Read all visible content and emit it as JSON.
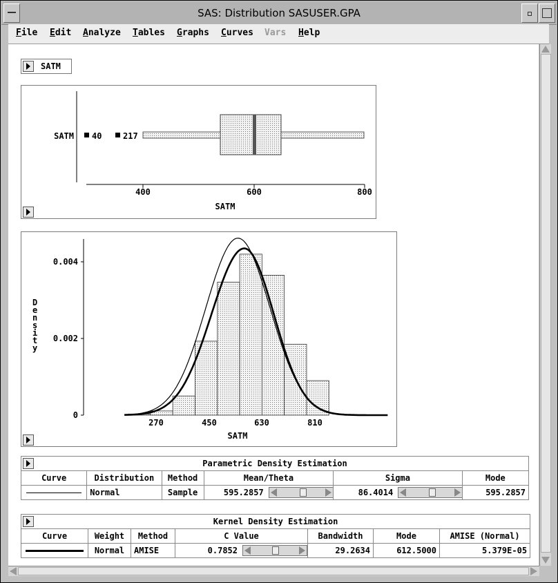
{
  "window": {
    "title": "SAS: Distribution SASUSER.GPA"
  },
  "menu": [
    {
      "label": "File",
      "enabled": true
    },
    {
      "label": "Edit",
      "enabled": true
    },
    {
      "label": "Analyze",
      "enabled": true
    },
    {
      "label": "Tables",
      "enabled": true
    },
    {
      "label": "Graphs",
      "enabled": true
    },
    {
      "label": "Curves",
      "enabled": true
    },
    {
      "label": "Vars",
      "enabled": false
    },
    {
      "label": "Help",
      "enabled": true
    }
  ],
  "variable_button": {
    "label": "SATM"
  },
  "boxplot": {
    "var_label": "SATM",
    "outliers": [
      {
        "label": "40",
        "value": 285
      },
      {
        "label": "217",
        "value": 340
      }
    ],
    "whisker_low": 400,
    "q1": 545,
    "median": 600,
    "q3": 650,
    "whisker_high": 800,
    "xaxis": {
      "label": "SATM",
      "ticks": [
        "400",
        "600",
        "800"
      ],
      "range": [
        300,
        800
      ]
    }
  },
  "histogram": {
    "ylabel": "Density",
    "xlabel": "SATM",
    "yticks": [
      "0",
      "0.002",
      "0.004"
    ],
    "xticks": [
      "270",
      "450",
      "630",
      "810"
    ]
  },
  "chart_data": {
    "type": "bar",
    "title": "",
    "xlabel": "SATM",
    "ylabel": "Density",
    "bin_width": 60,
    "bin_starts": [
      300,
      360,
      420,
      480,
      540,
      600,
      660,
      720,
      780
    ],
    "values": [
      3e-05,
      0.00011,
      0.0005,
      0.00193,
      0.00347,
      0.0042,
      0.00365,
      0.00185,
      0.0009
    ],
    "ylim": [
      0,
      0.0045
    ],
    "xlim": [
      180,
      990
    ],
    "series": [
      {
        "name": "Normal",
        "mean": 595.2857,
        "sigma": 86.4014
      },
      {
        "name": "Kernel",
        "bandwidth": 29.2634,
        "mode": 612.5
      }
    ]
  },
  "parametric": {
    "title": "Parametric Density Estimation",
    "headers": [
      "Curve",
      "Distribution",
      "Method",
      "Mean/Theta",
      "Sigma",
      "Mode"
    ],
    "row": {
      "distribution": "Normal",
      "method": "Sample",
      "mean": "595.2857",
      "sigma": "86.4014",
      "mode": "595.2857"
    }
  },
  "kernel": {
    "title": "Kernel Density Estimation",
    "headers": [
      "Curve",
      "Weight",
      "Method",
      "C Value",
      "Bandwidth",
      "Mode",
      "AMISE (Normal)"
    ],
    "row": {
      "weight": "Normal",
      "method": "AMISE",
      "c_value": "0.7852",
      "bandwidth": "29.2634",
      "mode": "612.5000",
      "amise": "5.379E-05"
    }
  }
}
